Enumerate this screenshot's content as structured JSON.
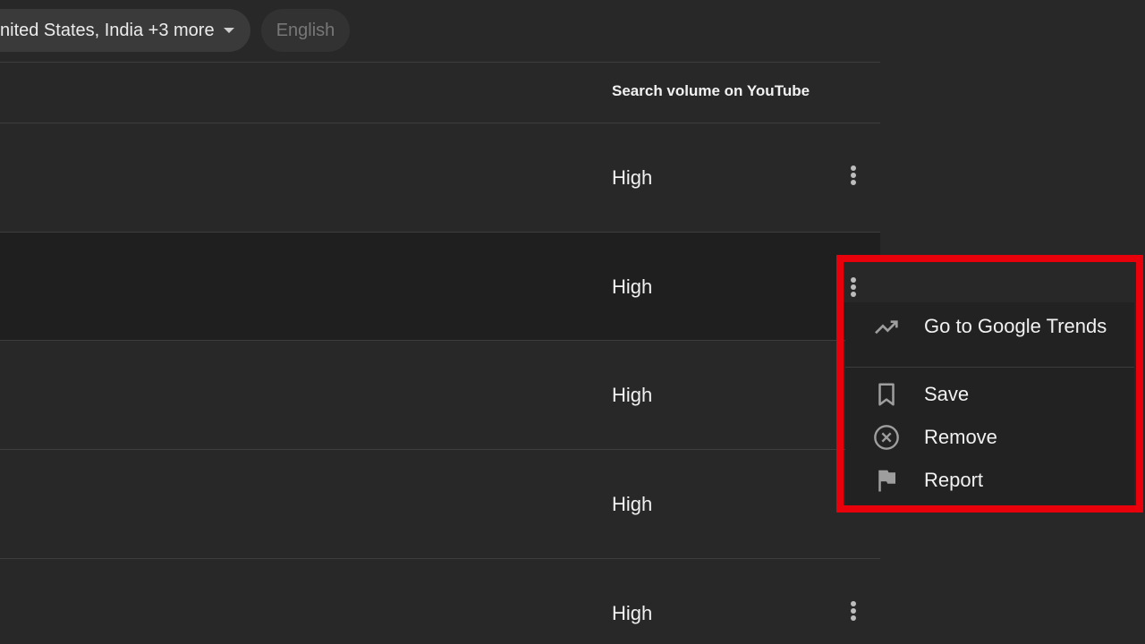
{
  "filters": {
    "country": "nited States, India +3 more",
    "language": "English"
  },
  "table": {
    "column_header": "Search volume on YouTube",
    "rows": [
      {
        "volume": "High"
      },
      {
        "volume": "High"
      },
      {
        "volume": "High"
      },
      {
        "volume": "High"
      },
      {
        "volume": "High"
      }
    ]
  },
  "menu": {
    "items": [
      {
        "label": "Go to Google Trends",
        "icon": "trending-up-icon"
      },
      {
        "label": "Save",
        "icon": "bookmark-icon"
      },
      {
        "label": "Remove",
        "icon": "remove-circle-icon"
      },
      {
        "label": "Report",
        "icon": "flag-icon"
      }
    ],
    "highlight_color": "#e8000b"
  }
}
